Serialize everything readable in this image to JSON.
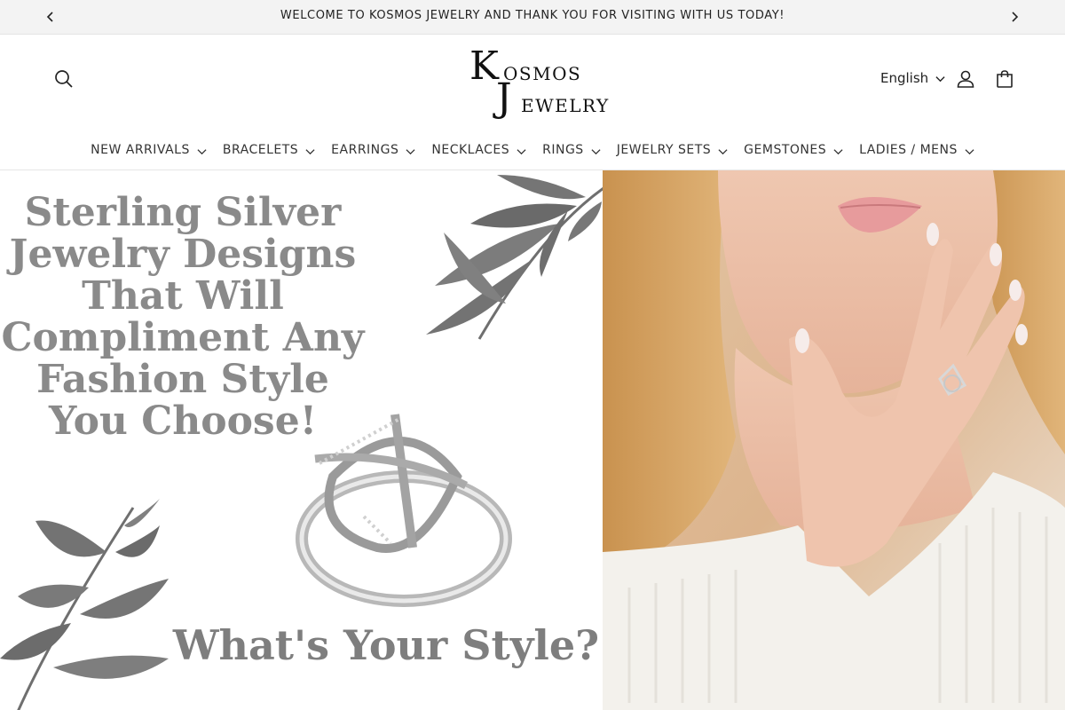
{
  "announcement": {
    "text": "WELCOME TO KOSMOS JEWELRY AND THANK YOU FOR VISITING WITH US TODAY!",
    "prev_icon": "chevron-left-icon",
    "next_icon": "chevron-right-icon"
  },
  "header": {
    "logo": {
      "k": "K",
      "osmos": "OSMOS",
      "j": "J",
      "ewelry": "EWELRY"
    },
    "language": "English",
    "icons": [
      "search-icon",
      "account-icon",
      "cart-icon"
    ]
  },
  "nav": {
    "items": [
      {
        "label": "NEW ARRIVALS"
      },
      {
        "label": "BRACELETS"
      },
      {
        "label": "EARRINGS"
      },
      {
        "label": "NECKLACES"
      },
      {
        "label": "RINGS"
      },
      {
        "label": "JEWELRY SETS"
      },
      {
        "label": "GEMSTONES"
      },
      {
        "label": "LADIES / MENS"
      }
    ]
  },
  "hero": {
    "headline": "Sterling Silver Jewelry Designs That Will Compliment Any Fashion Style You Choose!",
    "tagline": "What's Your Style?"
  },
  "colors": {
    "announcement_bg": "#f3f3f3",
    "headline_text": "#8a8a8a",
    "text_dark": "#222222"
  }
}
